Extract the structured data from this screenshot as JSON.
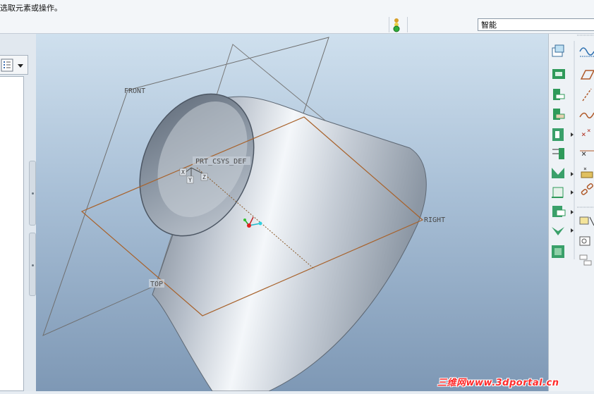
{
  "status_bar": {
    "message": "选取元素或操作。"
  },
  "filter": {
    "value": "智能"
  },
  "datum_labels": {
    "front": "FRONT",
    "right": "RIGHT",
    "top": "TOP",
    "csys": "PRT_CSYS_DEF"
  },
  "csys_axes": {
    "x": "X",
    "y": "Y",
    "z": "Z"
  },
  "watermark": {
    "text": "三维网www.3dportal.cn"
  },
  "colors": {
    "datum_plane": "#7f7f7f",
    "datum_plane_selected": "#b06a2e",
    "model_surface": "#c8ced6",
    "viewport_top": "#cfe0ee",
    "viewport_bottom": "#7e98b5",
    "watermark": "#ff2a2a"
  },
  "toolbar_icons_left": [
    "datum-plane-icon",
    "datum-axis-icon",
    "datum-point-icon",
    "datum-csys-icon",
    "extrude-icon",
    "revolve-icon",
    "sweep-icon",
    "blend-icon",
    "shell-icon",
    "rib-icon",
    "draft-icon"
  ],
  "toolbar_icons_right": [
    "sketch-curve-icon",
    "datum-plane-offset-icon",
    "datum-axis-line-icon",
    "spline-curve-icon",
    "datum-point-cross-icon",
    "offset-point-icon",
    "field-point-icon",
    "chain-icon",
    "sketch-rectangle-icon",
    "note-icon",
    "layer-tree-icon"
  ]
}
